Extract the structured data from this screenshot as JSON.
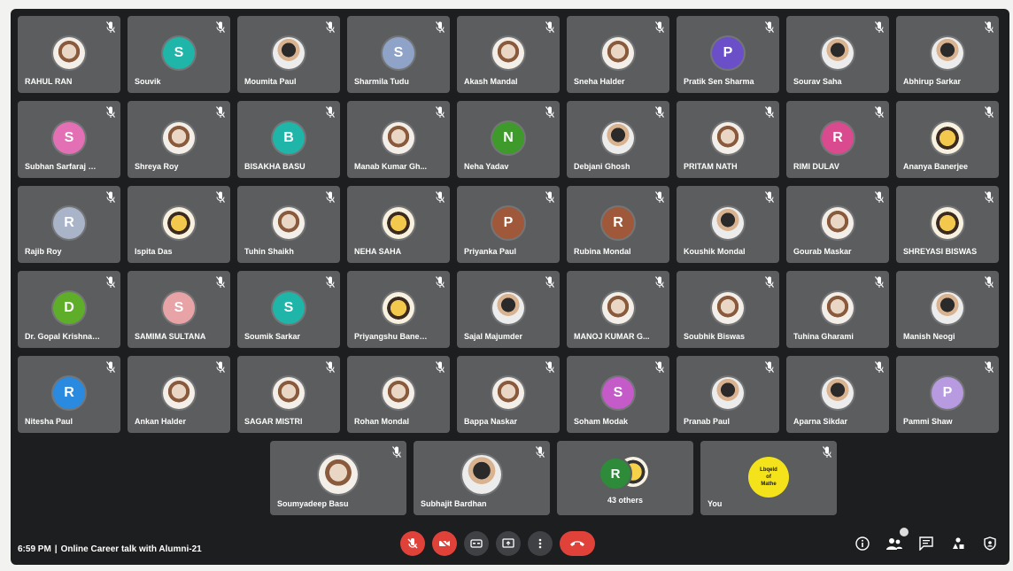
{
  "colors": {
    "tile_bg": "#5b5d5e",
    "screen_bg": "#1d1e20",
    "danger": "#e0423a"
  },
  "participants_rows": [
    [
      {
        "name": "RAHUL RAN",
        "avatar": "photo",
        "color": "#ffffff"
      },
      {
        "name": "Souvik",
        "avatar": "S",
        "color": "#1fb5a8"
      },
      {
        "name": "Moumita Paul",
        "avatar": "photo2",
        "color": "#ffffff"
      },
      {
        "name": "Sharmila Tudu",
        "avatar": "S",
        "color": "#8fa3c8"
      },
      {
        "name": "Akash Mandal",
        "avatar": "photo",
        "color": "#ffffff"
      },
      {
        "name": "Sneha Halder",
        "avatar": "photo",
        "color": "#ffffff"
      },
      {
        "name": "Pratik Sen Sharma",
        "avatar": "P",
        "color": "#6b4fc8"
      },
      {
        "name": "Sourav Saha",
        "avatar": "photo2",
        "color": "#ffffff"
      },
      {
        "name": "Abhirup Sarkar",
        "avatar": "photo2",
        "color": "#ffffff"
      }
    ],
    [
      {
        "name": "Subhan Sarfaraj M...",
        "avatar": "S",
        "color": "#e36fb5"
      },
      {
        "name": "Shreya Roy",
        "avatar": "photo",
        "color": "#ffffff"
      },
      {
        "name": "BISAKHA BASU",
        "avatar": "B",
        "color": "#1fb5a8"
      },
      {
        "name": "Manab Kumar Gh...",
        "avatar": "photo",
        "color": "#ffffff"
      },
      {
        "name": "Neha Yadav",
        "avatar": "N",
        "color": "#3f9a2c"
      },
      {
        "name": "Debjani Ghosh",
        "avatar": "photo2",
        "color": "#ffffff"
      },
      {
        "name": "PRITAM NATH",
        "avatar": "photo",
        "color": "#ffffff"
      },
      {
        "name": "RIMI DULAV",
        "avatar": "R",
        "color": "#d94a8f"
      },
      {
        "name": "Ananya Banerjee",
        "avatar": "photo3",
        "color": "#ffffff"
      }
    ],
    [
      {
        "name": "Rajib Roy",
        "avatar": "R",
        "color": "#a9b4c9"
      },
      {
        "name": "Ispita Das",
        "avatar": "photo3",
        "color": "#ffffff"
      },
      {
        "name": "Tuhin Shaikh",
        "avatar": "photo",
        "color": "#ffffff"
      },
      {
        "name": "NEHA SAHA",
        "avatar": "photo3",
        "color": "#ffffff"
      },
      {
        "name": "Priyanka Paul",
        "avatar": "P",
        "color": "#a0583a"
      },
      {
        "name": "Rubina Mondal",
        "avatar": "R",
        "color": "#a0583a"
      },
      {
        "name": "Koushik Mondal",
        "avatar": "photo2",
        "color": "#ffffff"
      },
      {
        "name": "Gourab Maskar",
        "avatar": "photo",
        "color": "#ffffff"
      },
      {
        "name": "SHREYASI BISWAS",
        "avatar": "photo3",
        "color": "#ffffff"
      }
    ],
    [
      {
        "name": "Dr. Gopal Krishna ...",
        "avatar": "D",
        "color": "#5fae2a"
      },
      {
        "name": "SAMIMA SULTANA",
        "avatar": "S",
        "color": "#e8a3a7"
      },
      {
        "name": "Soumik Sarkar",
        "avatar": "S",
        "color": "#1fb5a8"
      },
      {
        "name": "Priyangshu Banerj...",
        "avatar": "photo3",
        "color": "#ffffff"
      },
      {
        "name": "Sajal Majumder",
        "avatar": "photo2",
        "color": "#ffffff"
      },
      {
        "name": "MANOJ KUMAR G...",
        "avatar": "photo",
        "color": "#ffffff"
      },
      {
        "name": "Soubhik Biswas",
        "avatar": "photo",
        "color": "#ffffff"
      },
      {
        "name": "Tuhina Gharami",
        "avatar": "photo",
        "color": "#ffffff"
      },
      {
        "name": "Manish Neogi",
        "avatar": "photo2",
        "color": "#ffffff"
      }
    ],
    [
      {
        "name": "Nitesha Paul",
        "avatar": "R",
        "color": "#2a8ae0"
      },
      {
        "name": "Ankan Halder",
        "avatar": "photo",
        "color": "#ffffff"
      },
      {
        "name": "SAGAR MISTRI",
        "avatar": "photo",
        "color": "#ffffff"
      },
      {
        "name": "Rohan Mondal",
        "avatar": "photo",
        "color": "#ffffff"
      },
      {
        "name": "Bappa Naskar",
        "avatar": "photo",
        "color": "#ffffff"
      },
      {
        "name": "Soham Modak",
        "avatar": "S",
        "color": "#c45bc9"
      },
      {
        "name": "Pranab Paul",
        "avatar": "photo2",
        "color": "#ffffff"
      },
      {
        "name": "Aparna Sikdar",
        "avatar": "photo2",
        "color": "#ffffff"
      },
      {
        "name": "Pammi Shaw",
        "avatar": "P",
        "color": "#b89ae0"
      }
    ]
  ],
  "last_row": {
    "p1": {
      "name": "Soumyadeep Basu"
    },
    "p2": {
      "name": "Subhajit Bardhan"
    },
    "others": {
      "label": "43 others",
      "avatar_letter": "R"
    },
    "you": {
      "name": "You",
      "avatar_text_line1": "Lbqeld",
      "avatar_text_line2": "of",
      "avatar_text_line3": "Mathe"
    }
  },
  "bottom_bar": {
    "time": "6:59 PM",
    "separator": "|",
    "meeting_title": "Online Career talk with Alumni-21"
  },
  "icons": {
    "mic_muted": "mic-off-icon",
    "cam_off": "camera-off-icon",
    "captions": "captions-icon",
    "present": "present-icon",
    "more": "more-options-icon",
    "hangup": "hangup-icon",
    "info": "info-icon",
    "people": "people-icon",
    "chat": "chat-icon",
    "activities": "activities-icon",
    "host": "host-controls-icon"
  }
}
